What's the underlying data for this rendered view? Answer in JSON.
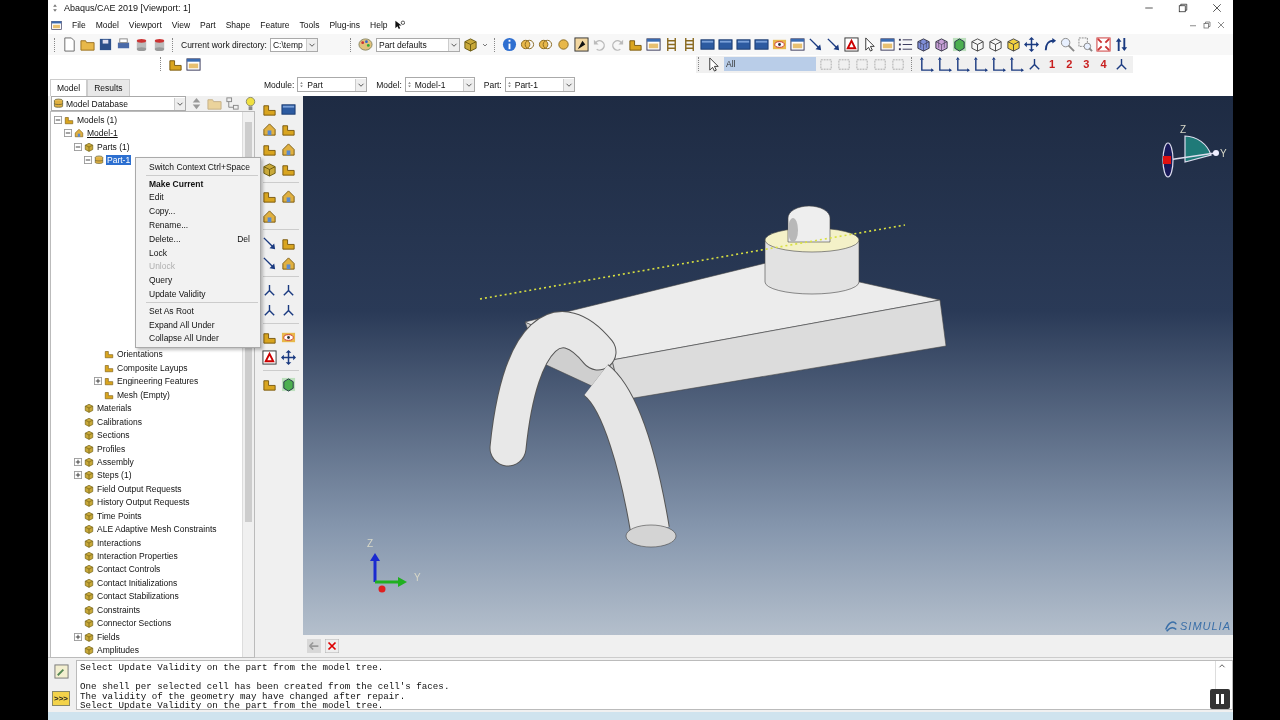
{
  "window": {
    "title": "Abaqus/CAE 2019 [Viewport: 1]"
  },
  "menu_bar": [
    {
      "label": "File"
    },
    {
      "label": "Model"
    },
    {
      "label": "Viewport"
    },
    {
      "label": "View"
    },
    {
      "label": "Part"
    },
    {
      "label": "Shape"
    },
    {
      "label": "Feature"
    },
    {
      "label": "Tools"
    },
    {
      "label": "Plug-ins"
    },
    {
      "label": "Help"
    }
  ],
  "toolbar": {
    "work_directory_label": "Current work directory:",
    "work_directory": "C:\\temp",
    "display_group": "Part defaults",
    "selection_filter": "All",
    "view_numbers": [
      "1",
      "2",
      "3",
      "4"
    ]
  },
  "tabs": [
    {
      "label": "Model",
      "selected": true
    },
    {
      "label": "Results",
      "selected": false
    }
  ],
  "context_bar": {
    "module_label": "Module:",
    "module": "Part",
    "model_label": "Model:",
    "model": "Model-1",
    "part_label": "Part:",
    "part": "Part-1"
  },
  "tree_source": "Model Database",
  "tree": [
    {
      "label": "Models (1)",
      "expanded": true,
      "selected": false,
      "children": [
        {
          "label": "Model-1",
          "expanded": true,
          "selected": false,
          "current": true,
          "children": [
            {
              "label": "Parts (1)",
              "expanded": true,
              "selected": false,
              "children": [
                {
                  "label": "Part-1",
                  "expanded": true,
                  "selected": true,
                  "children": [
                    {
                      "label": "Orientations",
                      "selected": false
                    },
                    {
                      "label": "Composite Layups",
                      "selected": false
                    },
                    {
                      "label": "Engineering Features",
                      "expanded": false,
                      "selected": false
                    },
                    {
                      "label": "Mesh (Empty)",
                      "selected": false
                    }
                  ]
                }
              ]
            },
            {
              "label": "Materials",
              "selected": false
            },
            {
              "label": "Calibrations",
              "selected": false
            },
            {
              "label": "Sections",
              "selected": false
            },
            {
              "label": "Profiles",
              "selected": false
            },
            {
              "label": "Assembly",
              "expanded": false,
              "selected": false
            },
            {
              "label": "Steps (1)",
              "expanded": false,
              "selected": false
            },
            {
              "label": "Field Output Requests",
              "selected": false
            },
            {
              "label": "History Output Requests",
              "selected": false
            },
            {
              "label": "Time Points",
              "selected": false
            },
            {
              "label": "ALE Adaptive Mesh Constraints",
              "selected": false
            },
            {
              "label": "Interactions",
              "selected": false
            },
            {
              "label": "Interaction Properties",
              "selected": false
            },
            {
              "label": "Contact Controls",
              "selected": false
            },
            {
              "label": "Contact Initializations",
              "selected": false
            },
            {
              "label": "Contact Stabilizations",
              "selected": false
            },
            {
              "label": "Constraints",
              "selected": false
            },
            {
              "label": "Connector Sections",
              "selected": false
            },
            {
              "label": "Fields",
              "expanded": false,
              "selected": false
            },
            {
              "label": "Amplitudes",
              "selected": false
            }
          ]
        }
      ]
    }
  ],
  "context_menu": [
    {
      "kind": "item",
      "label": "Switch Context",
      "shortcut": "Ctrl+Space",
      "default": false,
      "disabled": false
    },
    {
      "kind": "separator"
    },
    {
      "kind": "item",
      "label": "Make Current",
      "default": true,
      "disabled": false
    },
    {
      "kind": "item",
      "label": "Edit",
      "default": false,
      "disabled": false
    },
    {
      "kind": "item",
      "label": "Copy...",
      "default": false,
      "disabled": false
    },
    {
      "kind": "item",
      "label": "Rename...",
      "default": false,
      "disabled": false
    },
    {
      "kind": "item",
      "label": "Delete...",
      "shortcut": "Del",
      "default": false,
      "disabled": false
    },
    {
      "kind": "item",
      "label": "Lock",
      "default": false,
      "disabled": false
    },
    {
      "kind": "item",
      "label": "Unlock",
      "default": false,
      "disabled": true
    },
    {
      "kind": "item",
      "label": "Query",
      "default": false,
      "disabled": false
    },
    {
      "kind": "item",
      "label": "Update Validity",
      "default": false,
      "disabled": false
    },
    {
      "kind": "separator"
    },
    {
      "kind": "item",
      "label": "Set As Root",
      "default": false,
      "disabled": false
    },
    {
      "kind": "item",
      "label": "Expand All Under",
      "default": false,
      "disabled": false
    },
    {
      "kind": "item",
      "label": "Collapse All Under",
      "default": false,
      "disabled": false
    }
  ],
  "viewport": {
    "view_triad": {
      "z": "Z",
      "y": "Y"
    },
    "global_triad": {
      "z": "Z",
      "y": "Y"
    },
    "brand": "SIMULIA"
  },
  "message_area": {
    "kernel_button": ">>>",
    "blocks": [
      [
        "Select Update Validity on the part from the model tree."
      ],
      [
        "One shell per selected cell has been created from the cell's faces.",
        "The validity of the geometry may have changed after repair.",
        "Select Update Validity on the part from the model tree."
      ]
    ]
  }
}
